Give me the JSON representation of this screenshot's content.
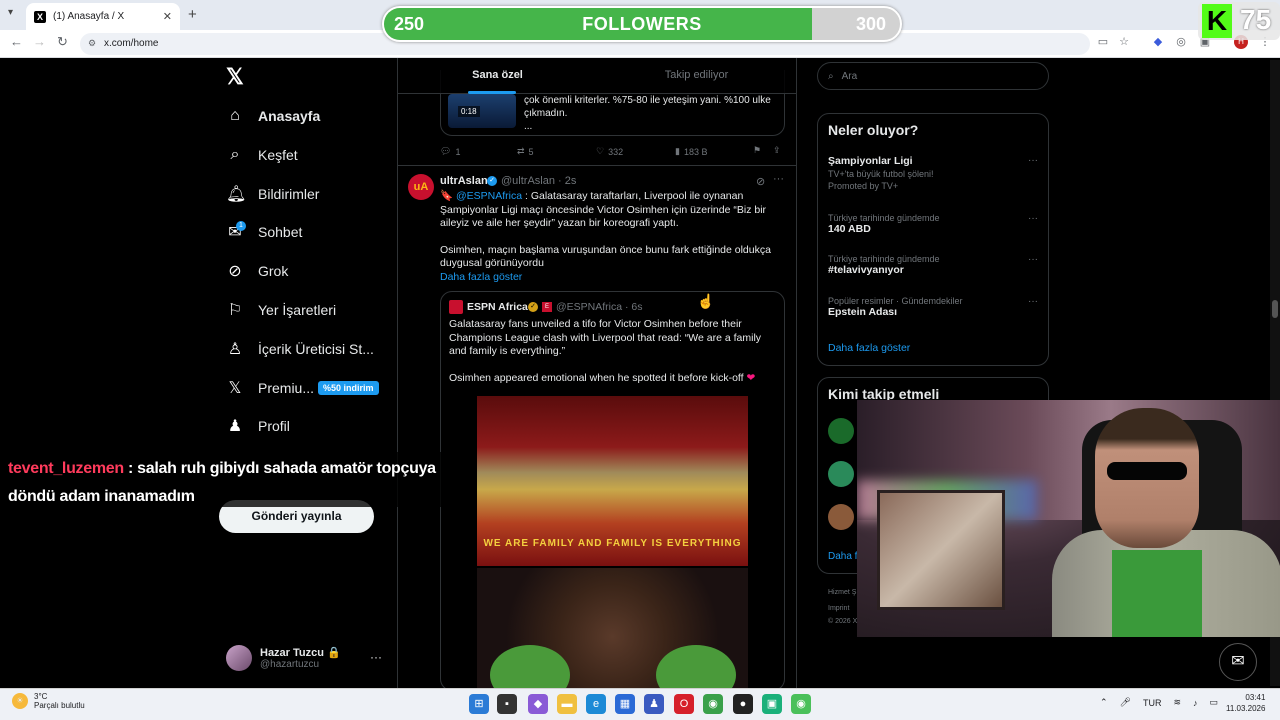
{
  "browser": {
    "tab_title": "(1) Anasayfa / X",
    "tab_favicon": "X",
    "tab_close": "✕",
    "new_tab": "+",
    "url": "x.com/home"
  },
  "overlay": {
    "followers_current": "250",
    "followers_label": "FOLLOWERS",
    "followers_goal": "300",
    "followers_progress": 0.83,
    "kick_logo": "K",
    "kick_count": "75"
  },
  "nav": {
    "logo": "𝕏",
    "items": [
      {
        "label": "Anasayfa",
        "icon": "home-icon"
      },
      {
        "label": "Keşfet",
        "icon": "search-icon"
      },
      {
        "label": "Bildirimler",
        "icon": "bell-icon"
      },
      {
        "label": "Sohbet",
        "icon": "mail-icon"
      },
      {
        "label": "Grok",
        "icon": "grok-icon"
      },
      {
        "label": "Yer İşaretleri",
        "icon": "bookmark-icon"
      },
      {
        "label": "İçerik Üreticisi St...",
        "icon": "creator-icon"
      },
      {
        "label": "Premiu...",
        "icon": "x-icon"
      },
      {
        "label": "Profil",
        "icon": "person-icon"
      }
    ],
    "chat_badge": "1",
    "premium_badge": "%50 indirim",
    "post_button": "Gönderi yayınla",
    "user_name": "Hazar Tuzcu 🔒",
    "user_handle": "@hazartuzcu",
    "user_more": "···"
  },
  "feed": {
    "tabs": [
      "Sana özel",
      "Takip ediliyor"
    ],
    "prev_video_duration": "0:18",
    "prev_text_1": "çok önemli kriterler. %75-80 ile yeteşim yani. %100 ulke",
    "prev_text_2": "çıkmadın.",
    "prev_text_3": "...",
    "prev_actions": {
      "replies": "1",
      "reposts": "5",
      "likes": "332",
      "views": "183 B"
    },
    "tweet": {
      "avatar_text": "uA",
      "name": "ultrAslan",
      "handle": "@ultrAslan · 2s",
      "body_mention": "@ESPNAfrica",
      "body_1_pre": "🔖 ",
      "body_1": " : Galatasaray taraftarları, Liverpool ile oynanan Şampiyonlar Ligi maçı öncesinde Victor Osimhen için üzerinde “Biz bir aileyiz ve aile her şeydir” yazan bir koreografi yaptı.",
      "body_2": "Osimhen, maçın başlama vuruşundan önce bunu fark ettiğinde oldukça duygusal görünüyordu",
      "show_more": "Daha fazla göster"
    },
    "quote": {
      "name": "ESPN Africa",
      "handle": "@ESPNAfrica · 6s",
      "body_1": "Galatasaray fans unveiled a tifo for Victor Osimhen before their Champions League clash with Liverpool that read: “We are a family and family is everything.”",
      "body_2": "Osimhen appeared emotional when he spotted it before kick-off",
      "heart": "❤",
      "banner_text": "WE ARE FAMILY AND FAMILY IS EVERYTHING"
    }
  },
  "right": {
    "search_placeholder": "Ara",
    "trends_title": "Neler oluyor?",
    "trends": [
      {
        "context": "",
        "name": "Şampiyonlar Ligi",
        "sub": "TV+'ta büyük futbol şöleni!",
        "promo": "Promoted by TV+"
      },
      {
        "context": "Türkiye tarihinde gündemde",
        "name": "140 ABD",
        "sub": "",
        "promo": ""
      },
      {
        "context": "Türkiye tarihinde gündemde",
        "name": "#telavivyanıyor",
        "sub": "",
        "promo": ""
      },
      {
        "context": "Popüler resimler · Gündemdekiler",
        "name": "Epstein Adası",
        "sub": "",
        "promo": ""
      }
    ],
    "trends_more": "Daha fazla göster",
    "who_title": "Kimi takip etmeli",
    "who_more": "Daha f",
    "footer": [
      "Hizmet Ş",
      "Imprint",
      "© 2026 X"
    ]
  },
  "chat": {
    "user": "tevent_luzemen",
    "message": ": salah ruh gibiydı sahada amatör topçuya döndü adam inanamadım"
  },
  "taskbar": {
    "temp": "3°C",
    "condition": "Parçalı bulutlu",
    "lang": "TUR",
    "time": "03:41",
    "date": "11.03.2026"
  }
}
